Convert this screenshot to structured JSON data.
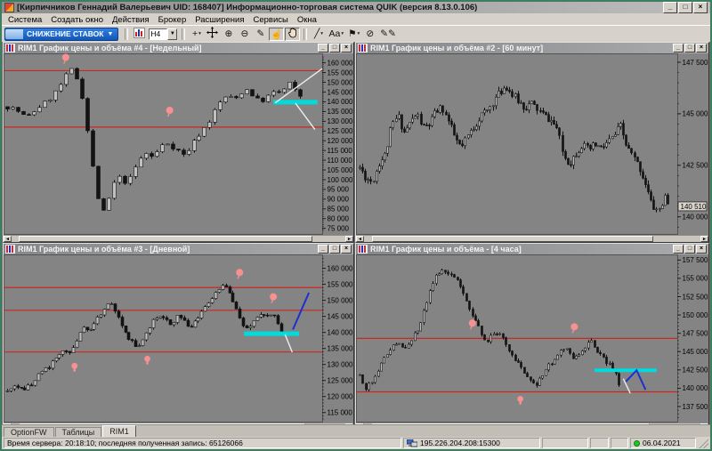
{
  "window": {
    "title": "[Кирпичников Геннадий Валерьевич UID: 168407] Информационно-торговая система QUIK (версия 8.13.0.106)",
    "buttons": [
      {
        "name": "minimize-button",
        "glyph": "_"
      },
      {
        "name": "maximize-button",
        "glyph": "□"
      },
      {
        "name": "close-button",
        "glyph": "×"
      }
    ]
  },
  "menu": {
    "items": [
      "Система",
      "Создать окно",
      "Действия",
      "Брокер",
      "Расширения",
      "Сервисы",
      "Окна"
    ]
  },
  "toolbar": {
    "promo_label": "СНИЖЕНИЕ СТАВОК",
    "promo_arrow": "▼",
    "items": [
      {
        "sep": true
      },
      {
        "name": "new-chart-button",
        "icon": "chart"
      },
      {
        "name": "timeframe-select",
        "combo": "H4",
        "arrow": "▼"
      },
      {
        "sep": true
      },
      {
        "name": "crosshair-tool-button",
        "glyph": "+",
        "dropdown": true
      },
      {
        "name": "move-tool-button",
        "icon": "move"
      },
      {
        "name": "zoom-in-button",
        "glyph": "⊕"
      },
      {
        "name": "zoom-out-button",
        "glyph": "⊖"
      },
      {
        "name": "pencil-tool-button",
        "glyph": "✎"
      },
      {
        "name": "pointer-hand-button",
        "glyph": "☝",
        "pressed": true
      },
      {
        "name": "pan-hand-button",
        "icon": "hand",
        "pressed": true
      },
      {
        "sep": true
      },
      {
        "name": "line-tool-button",
        "glyph": "╱",
        "dropdown": true
      },
      {
        "name": "text-tool-button",
        "glyph": "Aa",
        "dropdown": true
      },
      {
        "name": "flag-tool-button",
        "glyph": "⚑",
        "dropdown": true
      },
      {
        "name": "hide-objects-button",
        "glyph": "⊘"
      },
      {
        "name": "edit-objects-button",
        "glyph": "✎✎"
      }
    ]
  },
  "panels": [
    {
      "title": "RIM1 График цены и объёма #4 - [Недельный]",
      "timeframe": "Недельный",
      "seed": 7,
      "axis_w": 35,
      "y_min": 73500,
      "y_max": 163500,
      "tick_min": 75000,
      "tick_max": 160000,
      "tick_step": 5000,
      "minor_step": 1000,
      "candles": {
        "count": 56,
        "end_frac": 0.93,
        "vol": 2600,
        "body_w": 4,
        "path": [
          [
            0,
            137500
          ],
          [
            0.02,
            136500
          ],
          [
            0.04,
            134500
          ],
          [
            0.06,
            131500
          ],
          [
            0.08,
            134500
          ],
          [
            0.1,
            137500
          ],
          [
            0.12,
            139500
          ],
          [
            0.14,
            142500
          ],
          [
            0.16,
            146500
          ],
          [
            0.18,
            151500
          ],
          [
            0.2,
            157000
          ],
          [
            0.22,
            152000
          ],
          [
            0.24,
            141000
          ],
          [
            0.26,
            118000
          ],
          [
            0.28,
            96000
          ],
          [
            0.3,
            81500
          ],
          [
            0.32,
            89500
          ],
          [
            0.34,
            99000
          ],
          [
            0.36,
            101500
          ],
          [
            0.38,
            97500
          ],
          [
            0.4,
            104500
          ],
          [
            0.42,
            110500
          ],
          [
            0.44,
            113500
          ],
          [
            0.46,
            111500
          ],
          [
            0.48,
            115500
          ],
          [
            0.5,
            119500
          ],
          [
            0.52,
            117500
          ],
          [
            0.54,
            115000
          ],
          [
            0.56,
            112500
          ],
          [
            0.58,
            116500
          ],
          [
            0.6,
            121500
          ],
          [
            0.62,
            125500
          ],
          [
            0.64,
            129500
          ],
          [
            0.66,
            135500
          ],
          [
            0.68,
            140500
          ],
          [
            0.7,
            143500
          ],
          [
            0.72,
            140500
          ],
          [
            0.74,
            144500
          ],
          [
            0.76,
            146500
          ],
          [
            0.78,
            143500
          ],
          [
            0.8,
            140000
          ],
          [
            0.82,
            141500
          ],
          [
            0.84,
            144500
          ],
          [
            0.86,
            144500
          ],
          [
            0.88,
            146500
          ],
          [
            0.89,
            151000
          ],
          [
            0.905,
            147000
          ],
          [
            0.92,
            144000
          ],
          [
            0.93,
            143000
          ]
        ]
      },
      "red_lines": [
        156000,
        127000
      ],
      "cyan_bars": [
        {
          "x1": 0.845,
          "x2": 0.985,
          "price": 139800,
          "h": 5
        }
      ],
      "lines": [
        {
          "color": "white",
          "pts": [
            [
              0.851,
              139500
            ],
            [
              1.0,
              157000
            ]
          ]
        },
        {
          "color": "white",
          "pts": [
            [
              0.915,
              139300
            ],
            [
              0.977,
              125800
            ]
          ]
        }
      ],
      "markers": [
        {
          "type": "balloon",
          "x": 0.186,
          "price": 161000
        },
        {
          "type": "balloon",
          "x": 0.516,
          "price": 133800
        }
      ],
      "price_tag": null,
      "scroll": {
        "thumb": [
          0.02,
          0.9
        ]
      }
    },
    {
      "title": "RIM1 График цены и объёма #2 - [60 минут]",
      "timeframe": "60 минут",
      "seed": 11,
      "axis_w": 35,
      "y_min": 139300,
      "y_max": 147800,
      "tick_min": 140000,
      "tick_max": 147500,
      "tick_step": 2500,
      "minor_step": 500,
      "candles": {
        "count": 112,
        "end_frac": 0.969,
        "vol": 420,
        "body_w": 2,
        "path": [
          [
            0,
            142400
          ],
          [
            0.02,
            141900
          ],
          [
            0.04,
            141700
          ],
          [
            0.06,
            142600
          ],
          [
            0.08,
            143000
          ],
          [
            0.1,
            144400
          ],
          [
            0.12,
            144900
          ],
          [
            0.14,
            144100
          ],
          [
            0.16,
            144600
          ],
          [
            0.18,
            145000
          ],
          [
            0.2,
            144300
          ],
          [
            0.22,
            144500
          ],
          [
            0.24,
            145100
          ],
          [
            0.26,
            145300
          ],
          [
            0.28,
            144600
          ],
          [
            0.3,
            143800
          ],
          [
            0.32,
            143300
          ],
          [
            0.34,
            143900
          ],
          [
            0.36,
            144400
          ],
          [
            0.38,
            144900
          ],
          [
            0.4,
            145100
          ],
          [
            0.42,
            145600
          ],
          [
            0.44,
            146000
          ],
          [
            0.46,
            146400
          ],
          [
            0.48,
            145900
          ],
          [
            0.5,
            145600
          ],
          [
            0.52,
            145300
          ],
          [
            0.54,
            145500
          ],
          [
            0.56,
            145200
          ],
          [
            0.58,
            144900
          ],
          [
            0.6,
            144700
          ],
          [
            0.62,
            144300
          ],
          [
            0.64,
            143000
          ],
          [
            0.66,
            142600
          ],
          [
            0.68,
            143100
          ],
          [
            0.7,
            143500
          ],
          [
            0.72,
            143200
          ],
          [
            0.74,
            143500
          ],
          [
            0.76,
            143300
          ],
          [
            0.78,
            143600
          ],
          [
            0.8,
            143900
          ],
          [
            0.82,
            144400
          ],
          [
            0.84,
            143400
          ],
          [
            0.86,
            142900
          ],
          [
            0.88,
            142400
          ],
          [
            0.9,
            141600
          ],
          [
            0.92,
            140500
          ],
          [
            0.94,
            140300
          ],
          [
            0.96,
            140900
          ],
          [
            0.969,
            140600
          ]
        ]
      },
      "red_lines": [],
      "cyan_bars": [],
      "lines": [],
      "markers": [],
      "price_tag": 140510,
      "scroll": {
        "thumb": [
          0.025,
          0.86
        ]
      }
    },
    {
      "title": "RIM1 График цены и объёма #3 - [Дневной]",
      "timeframe": "Дневной",
      "seed": 5,
      "axis_w": 35,
      "y_min": 113000,
      "y_max": 163500,
      "tick_min": 115000,
      "tick_max": 160000,
      "tick_step": 5000,
      "minor_step": 1000,
      "candles": {
        "count": 80,
        "end_frac": 0.87,
        "vol": 1500,
        "body_w": 3,
        "path": [
          [
            0,
            121500
          ],
          [
            0.03,
            123500
          ],
          [
            0.05,
            122000
          ],
          [
            0.07,
            123500
          ],
          [
            0.1,
            126500
          ],
          [
            0.13,
            129000
          ],
          [
            0.16,
            132500
          ],
          [
            0.18,
            134500
          ],
          [
            0.2,
            134000
          ],
          [
            0.22,
            137500
          ],
          [
            0.24,
            141500
          ],
          [
            0.26,
            139500
          ],
          [
            0.28,
            143000
          ],
          [
            0.3,
            146500
          ],
          [
            0.32,
            149500
          ],
          [
            0.34,
            147500
          ],
          [
            0.36,
            143500
          ],
          [
            0.38,
            138500
          ],
          [
            0.4,
            136500
          ],
          [
            0.42,
            135800
          ],
          [
            0.44,
            139500
          ],
          [
            0.46,
            143500
          ],
          [
            0.48,
            146000
          ],
          [
            0.5,
            144500
          ],
          [
            0.52,
            142500
          ],
          [
            0.54,
            145500
          ],
          [
            0.56,
            143500
          ],
          [
            0.58,
            141500
          ],
          [
            0.6,
            144000
          ],
          [
            0.62,
            147000
          ],
          [
            0.64,
            150000
          ],
          [
            0.66,
            152500
          ],
          [
            0.69,
            155300
          ],
          [
            0.71,
            151500
          ],
          [
            0.73,
            146500
          ],
          [
            0.75,
            142500
          ],
          [
            0.76,
            141000
          ],
          [
            0.78,
            143500
          ],
          [
            0.8,
            145500
          ],
          [
            0.82,
            146000
          ],
          [
            0.84,
            145200
          ],
          [
            0.85,
            144500
          ],
          [
            0.86,
            142500
          ],
          [
            0.87,
            140200
          ]
        ]
      },
      "red_lines": [
        154000,
        146900,
        133900
      ],
      "cyan_bars": [
        {
          "x1": 0.752,
          "x2": 0.927,
          "price": 139600,
          "h": 5
        }
      ],
      "lines": [
        {
          "color": "blue",
          "pts": [
            [
              0.907,
              140900
            ],
            [
              0.958,
              152400
            ]
          ]
        },
        {
          "color": "white",
          "pts": [
            [
              0.882,
              139400
            ],
            [
              0.905,
              133800
            ]
          ]
        }
      ],
      "markers": [
        {
          "type": "balloon",
          "x": 0.738,
          "price": 157600
        },
        {
          "type": "balloon",
          "x": 0.845,
          "price": 150000
        },
        {
          "type": "hand",
          "x": 0.214,
          "price": 129000
        },
        {
          "type": "hand",
          "x": 0.445,
          "price": 131200
        }
      ],
      "price_tag": null,
      "scroll": {
        "thumb": [
          0.025,
          0.88
        ]
      }
    },
    {
      "title": "RIM1 График цены и объёма - [4 часа]",
      "timeframe": "4 часа",
      "seed": 13,
      "axis_w": 35,
      "y_min": 135800,
      "y_max": 157900,
      "tick_min": 137500,
      "tick_max": 157500,
      "tick_step": 2500,
      "minor_step": 500,
      "candles": {
        "count": 86,
        "end_frac": 0.815,
        "vol": 650,
        "body_w": 2,
        "path": [
          [
            0,
            141800
          ],
          [
            0.02,
            140000
          ],
          [
            0.04,
            141000
          ],
          [
            0.06,
            142800
          ],
          [
            0.08,
            144300
          ],
          [
            0.1,
            145600
          ],
          [
            0.12,
            146300
          ],
          [
            0.14,
            145400
          ],
          [
            0.16,
            146600
          ],
          [
            0.18,
            147600
          ],
          [
            0.2,
            150300
          ],
          [
            0.22,
            153000
          ],
          [
            0.24,
            155300
          ],
          [
            0.26,
            156300
          ],
          [
            0.28,
            155800
          ],
          [
            0.3,
            155300
          ],
          [
            0.32,
            153800
          ],
          [
            0.34,
            151300
          ],
          [
            0.36,
            149300
          ],
          [
            0.38,
            147800
          ],
          [
            0.4,
            146300
          ],
          [
            0.42,
            147300
          ],
          [
            0.44,
            147800
          ],
          [
            0.46,
            145800
          ],
          [
            0.48,
            144300
          ],
          [
            0.5,
            143300
          ],
          [
            0.52,
            141800
          ],
          [
            0.55,
            140300
          ],
          [
            0.57,
            141300
          ],
          [
            0.59,
            142800
          ],
          [
            0.61,
            143800
          ],
          [
            0.63,
            144800
          ],
          [
            0.65,
            145300
          ],
          [
            0.67,
            144300
          ],
          [
            0.69,
            144800
          ],
          [
            0.71,
            145800
          ],
          [
            0.73,
            146300
          ],
          [
            0.75,
            144800
          ],
          [
            0.77,
            143800
          ],
          [
            0.79,
            143300
          ],
          [
            0.8,
            142600
          ],
          [
            0.81,
            141300
          ],
          [
            0.815,
            140400
          ]
        ]
      },
      "red_lines": [
        146800,
        139500
      ],
      "cyan_bars": [
        {
          "x1": 0.739,
          "x2": 0.935,
          "price": 142450,
          "h": 4
        }
      ],
      "lines": [
        {
          "color": "blue",
          "pts": [
            [
              0.838,
              140900
            ],
            [
              0.872,
              142450
            ],
            [
              0.9,
              139800
            ]
          ]
        },
        {
          "color": "white",
          "pts": [
            [
              0.83,
              141300
            ],
            [
              0.852,
              139300
            ]
          ]
        }
      ],
      "markers": [
        {
          "type": "balloon",
          "x": 0.355,
          "price": 148400
        },
        {
          "type": "balloon",
          "x": 0.676,
          "price": 147900
        },
        {
          "type": "hand",
          "x": 0.506,
          "price": 138300
        }
      ],
      "price_tag": null,
      "scroll": {
        "thumb": [
          0.025,
          0.85
        ]
      }
    }
  ],
  "tabs": {
    "items": [
      "OptionFW",
      "Таблицы",
      "RIM1"
    ],
    "active": 2
  },
  "statusbar": {
    "left": "Время сервера: 20:18:10; последняя полученная запись: 65126066",
    "server": "195.226.204.208:15300",
    "date": "06.04.2021"
  },
  "colors": {
    "red_line": "#c8281e",
    "cyan": "#00dcdc",
    "blue_line": "#1d2fd0",
    "white_line": "#ededed",
    "pink": "#f79191",
    "candle": "#131313",
    "hollow": "#c0c0c0",
    "chart_bg": "#848484",
    "accent_blue": "#1b6ad2"
  }
}
